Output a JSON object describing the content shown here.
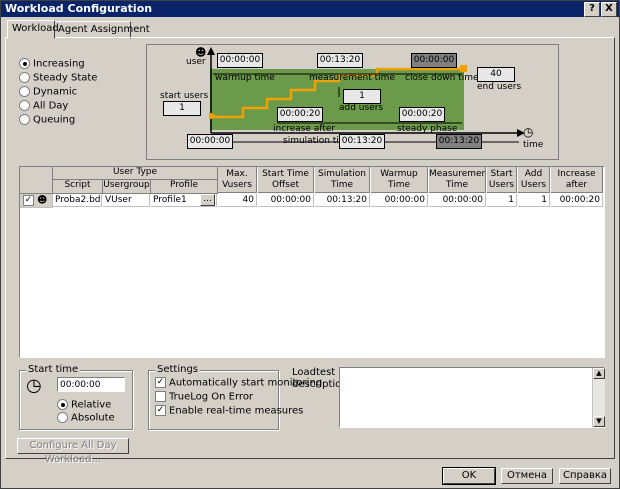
{
  "window": {
    "title": "Workload Configuration"
  },
  "tabs": [
    "Workload",
    "Agent Assignment"
  ],
  "modes": [
    {
      "label": "Increasing",
      "selected": true
    },
    {
      "label": "Steady State",
      "selected": false
    },
    {
      "label": "Dynamic",
      "selected": false
    },
    {
      "label": "All Day",
      "selected": false
    },
    {
      "label": "Queuing",
      "selected": false
    }
  ],
  "diagram": {
    "user_label": "user",
    "time_label": "time",
    "start_users_label": "start users",
    "start_users_value": "1",
    "end_users_label": "end users",
    "end_users_value": "40",
    "warmup_label": "warmup time",
    "warmup_value": "00:00:00",
    "measurement_label": "measurement time",
    "measurement_value": "00:13:20",
    "closedown_label": "close down time",
    "closedown_value": "00:00:00",
    "add_users_label": "add users",
    "add_users_value": "1",
    "increase_after_label": "increase after",
    "increase_after_value": "00:00:20",
    "steady_label": "steady phase",
    "steady_value": "00:00:20",
    "sim_start": "00:00:00",
    "sim_label": "simulation time:",
    "sim_value": "00:13:20",
    "sim_end": "00:13:20"
  },
  "grid": {
    "group_header": "User Type",
    "headers": [
      "Script",
      "Usergroup",
      "Profile",
      "Max. Vusers",
      "Start Time Offset",
      "Simulation Time",
      "Warmup Time",
      "Measurement Time",
      "Start Users",
      "Add Users",
      "Increase after"
    ],
    "row": {
      "script": "Proba2.bdf",
      "usergroup": "VUser",
      "profile": "Profile1",
      "browse": "...",
      "max_vusers": "40",
      "start_offset": "00:00:00",
      "simulation_time": "00:13:20",
      "warmup_time": "00:00:00",
      "measurement_time": "00:00:00",
      "start_users": "1",
      "add_users": "1",
      "increase_after": "00:00:20"
    }
  },
  "start_time": {
    "title": "Start time",
    "value": "00:00:00",
    "relative_label": "Relative",
    "absolute_label": "Absolute"
  },
  "settings": {
    "title": "Settings",
    "auto_monitor": "Automatically start monitoring",
    "truelog": "TrueLog On Error",
    "realtime": "Enable real-time measures"
  },
  "description": {
    "label_line1": "Loadtest",
    "label_line2": "description:"
  },
  "buttons": {
    "configure": "Configure All Day Workload...",
    "ok": "OK",
    "cancel": "Отмена",
    "help": "Справка"
  },
  "title_buttons": {
    "help": "?",
    "close": "X"
  }
}
